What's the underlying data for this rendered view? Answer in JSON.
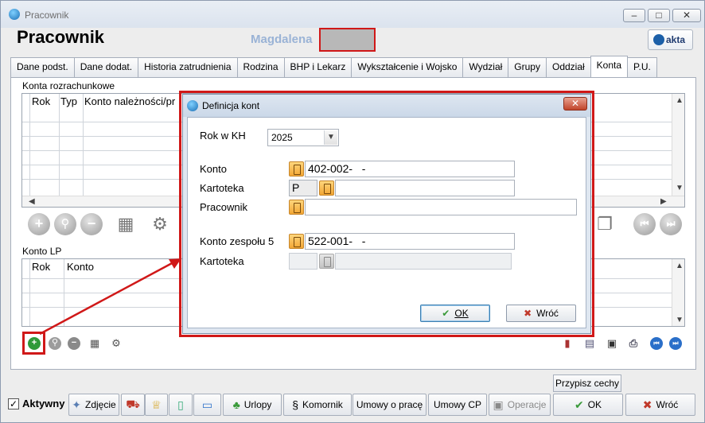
{
  "window": {
    "title": "Pracownik"
  },
  "header": {
    "title": "Pracownik",
    "employee_name": "Magdalena",
    "logo_text": "akta"
  },
  "tabs": [
    {
      "label": "Dane podst."
    },
    {
      "label": "Dane dodat."
    },
    {
      "label": "Historia zatrudnienia"
    },
    {
      "label": "Rodzina"
    },
    {
      "label": "BHP i Lekarz"
    },
    {
      "label": "Wykształcenie i Wojsko"
    },
    {
      "label": "Wydział"
    },
    {
      "label": "Grupy"
    },
    {
      "label": "Oddział"
    },
    {
      "label": "Konta"
    },
    {
      "label": "P.U."
    }
  ],
  "konta_rozrachunkowe": {
    "label": "Konta rozrachunkowe",
    "columns": [
      "Rok",
      "Typ",
      "Konto należności/pr"
    ]
  },
  "konto_lp": {
    "label": "Konto LP",
    "columns": [
      "Rok",
      "Konto"
    ]
  },
  "modal": {
    "title": "Definicja kont",
    "rok_label": "Rok w KH",
    "rok_value": "2025",
    "konto_label": "Konto",
    "konto_value": "402-002-   -",
    "kartoteka_label": "Kartoteka",
    "kartoteka_value": "P",
    "pracownik_label": "Pracownik",
    "konto_zespolu_label": "Konto zespołu 5",
    "konto_zespolu_value": "522-001-   -",
    "kartoteka2_label": "Kartoteka",
    "ok_label": "OK",
    "wroc_label": "Wróć"
  },
  "bottom": {
    "przypisz": "Przypisz cechy",
    "aktywny": "Aktywny",
    "zdjecie": "Zdjęcie",
    "urlopy": "Urlopy",
    "komornik": "Komornik",
    "umowy_o_prace": "Umowy o pracę",
    "umowy_cp": "Umowy CP",
    "operacje": "Operacje",
    "ok": "OK",
    "wroc": "Wróć"
  },
  "colors": {
    "highlight": "#d01818",
    "accent": "#1b6fb5"
  }
}
